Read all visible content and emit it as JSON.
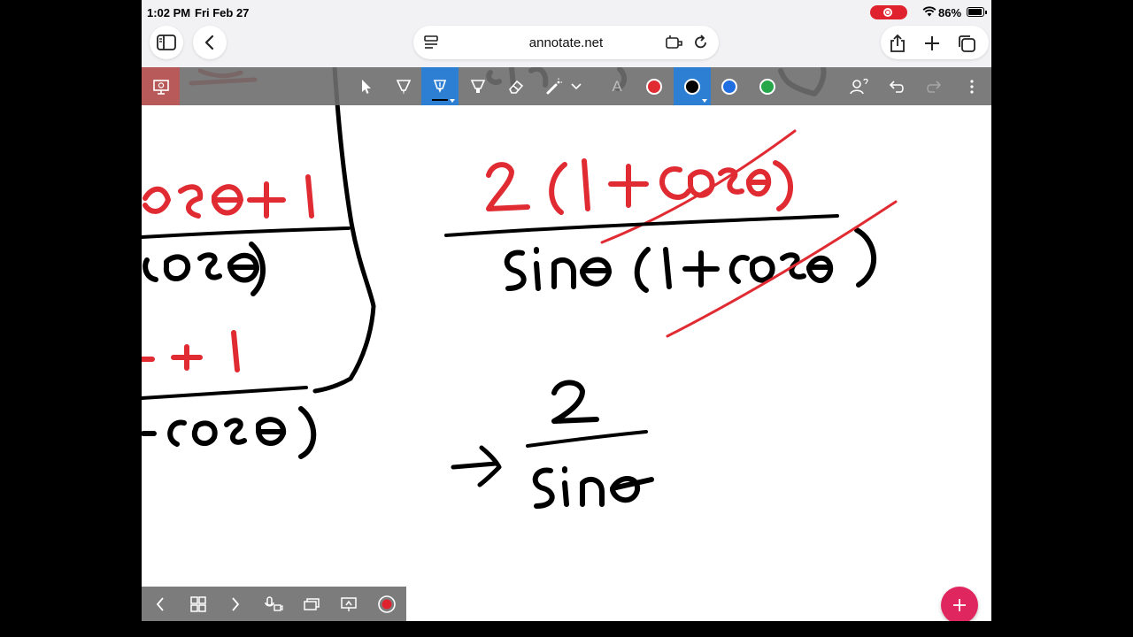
{
  "status_bar": {
    "time": "1:02 PM",
    "date": "Fri Feb 27",
    "battery_percent": "86%"
  },
  "browser": {
    "url": "annotate.net"
  },
  "toolbar": {
    "text_tool_label": "A",
    "colors": {
      "red": "#e02b33",
      "black": "#000000",
      "blue": "#1f6fe0",
      "green": "#26a84a"
    },
    "active_tool": "pen",
    "active_color": "black"
  },
  "icons": [
    "sidebar-icon",
    "back-icon",
    "reader-icon",
    "extension-icon",
    "reload-icon",
    "share-icon",
    "plus-icon",
    "tabs-icon",
    "present-icon",
    "pointer-icon",
    "highlighter-icon",
    "pen-icon",
    "marker-icon",
    "eraser-icon",
    "laser-icon",
    "chevron-down-icon",
    "text-icon",
    "user-icon",
    "undo-icon",
    "redo-icon",
    "more-icon",
    "prev-page-icon",
    "grid-icon",
    "next-page-icon",
    "mic-camera-icon",
    "screens-icon",
    "cast-icon",
    "record-icon",
    "add-icon"
  ],
  "accent_colors": {
    "toolbar_active": "#2d7fd3",
    "record": "#e0222f",
    "fab": "#e0265e"
  }
}
